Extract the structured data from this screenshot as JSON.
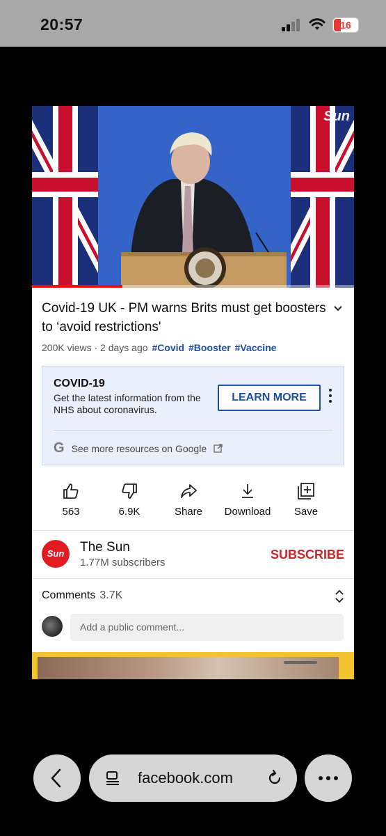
{
  "status_bar": {
    "time": "20:57",
    "battery": "16"
  },
  "video": {
    "watermark": "Sun"
  },
  "video_info": {
    "title": "Covid-19 UK - PM warns Brits must get boosters to ‘avoid restrictions'",
    "views": "200K views",
    "date": "2 days ago",
    "tags": [
      "#Covid",
      "#Booster",
      "#Vaccine"
    ]
  },
  "covid_panel": {
    "heading": "COVID-19",
    "text": "Get the latest information from the NHS about coronavirus.",
    "button": "LEARN MORE",
    "more_link": "See more resources on Google"
  },
  "actions": {
    "like": "563",
    "dislike": "6.9K",
    "share": "Share",
    "download": "Download",
    "save": "Save"
  },
  "channel": {
    "logo_text": "Sun",
    "name": "The Sun",
    "subscribers": "1.77M subscribers",
    "subscribe_label": "SUBSCRIBE"
  },
  "comments": {
    "label": "Comments",
    "count": "3.7K",
    "placeholder": "Add a public comment..."
  },
  "browser": {
    "url": "facebook.com"
  },
  "colors": {
    "accent_blue": "#1e4ea8",
    "subscribe_red": "#c62828",
    "sun_red": "#e11b22"
  }
}
